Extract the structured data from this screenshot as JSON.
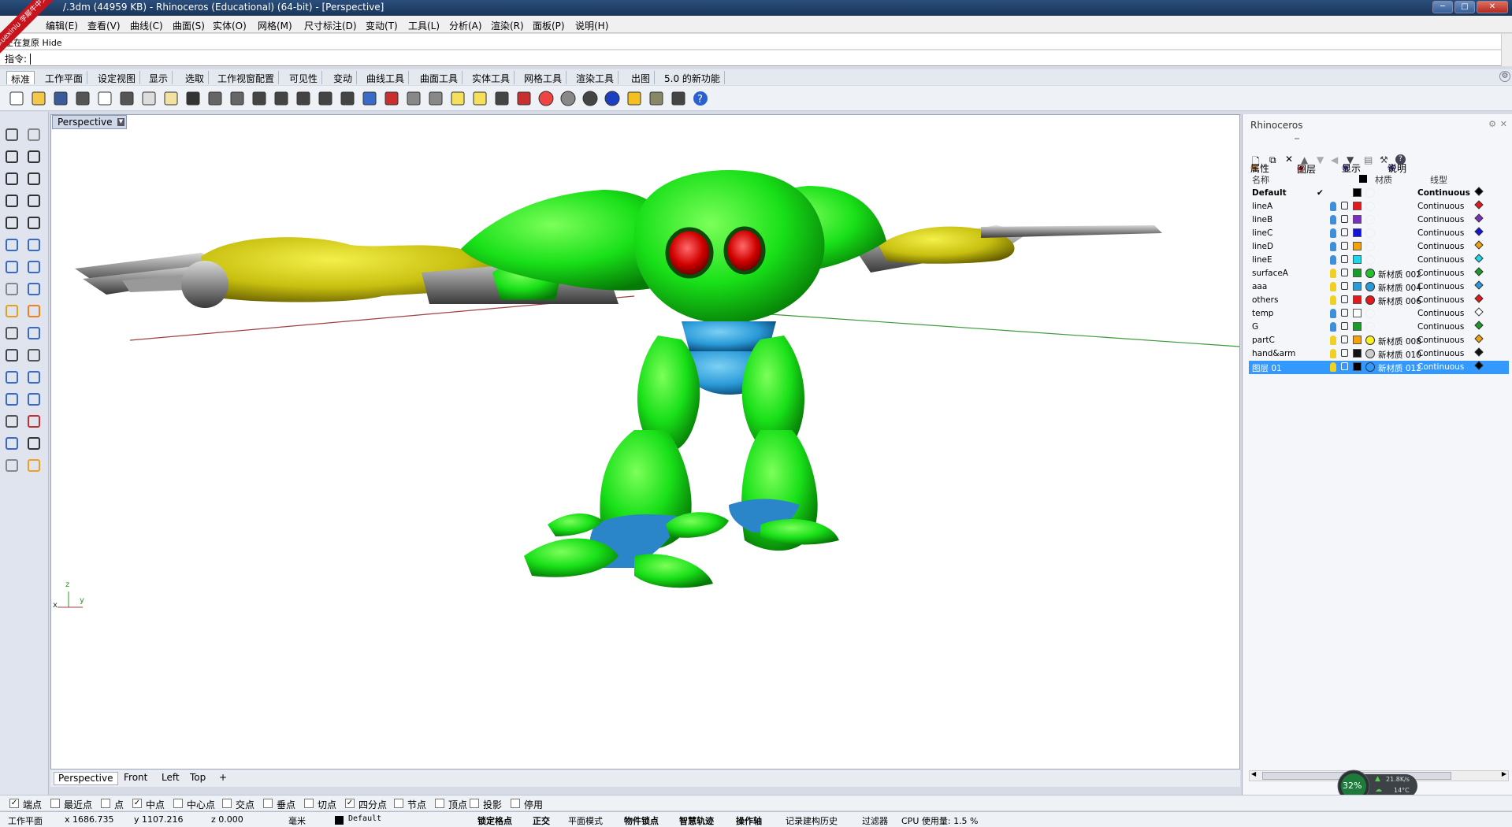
{
  "window": {
    "title": "/.3dm (44959 KB) - Rhinoceros (Educational) (64-bit) - [Perspective]",
    "watermark_line1": "xuexiniu",
    "watermark_line2": "学犀牛中文网"
  },
  "menu": [
    "编辑(E)",
    "查看(V)",
    "曲线(C)",
    "曲面(S)",
    "实体(O)",
    "网格(M)",
    "尺寸标注(D)",
    "变动(T)",
    "工具(L)",
    "分析(A)",
    "渲染(R)",
    "面板(P)",
    "说明(H)"
  ],
  "command": {
    "history": "正在复原 Hide",
    "prompt": "指令:",
    "value": ""
  },
  "toolbar_tabs": [
    "标准",
    "工作平面",
    "设定视图",
    "显示",
    "选取",
    "工作视窗配置",
    "可见性",
    "变动",
    "曲线工具",
    "曲面工具",
    "实体工具",
    "网格工具",
    "渲染工具",
    "出图",
    "5.0 的新功能"
  ],
  "toolbar_icons": [
    "new-icon",
    "open-icon",
    "save-icon",
    "print-icon",
    "import-icon",
    "cut-icon",
    "copy-icon",
    "paste-icon",
    "undo-icon",
    "pan-icon",
    "rotate-view-icon",
    "zoom-icon",
    "zoom-window-icon",
    "zoom-extents-icon",
    "zoom-selected-icon",
    "undo-view-icon",
    "four-viewports-icon",
    "car-icon",
    "wireframe-icon",
    "ghosted-icon",
    "light-icon",
    "bulb-icon",
    "lock-icon",
    "material-icon",
    "color-wheel-icon",
    "shaded-sphere-icon",
    "render-sphere-icon",
    "blue-sphere-icon",
    "select-icon",
    "options-icon",
    "cplane-icon",
    "help-icon"
  ],
  "viewport": {
    "active_label": "Perspective",
    "axis_x": "x",
    "axis_y": "y",
    "axis_z": "z",
    "tabs": [
      "Perspective",
      "Front",
      "Left",
      "Top"
    ],
    "add_tab": "+"
  },
  "panel": {
    "title": "Rhinoceros",
    "tabs": [
      "属性",
      "图层",
      "显示",
      "说明"
    ],
    "active_tab": "图层",
    "columns": {
      "name": "名称",
      "material": "材质",
      "linetype": "线型"
    },
    "layers": [
      {
        "name": "Default",
        "current": "✔",
        "color": "#000000",
        "material": "",
        "mat_color": "",
        "linetype": "Continuous",
        "print_color": "#000000",
        "bold": true,
        "bulb": ""
      },
      {
        "name": "lineA",
        "current": "",
        "color": "#e31a1c",
        "material": "",
        "mat_color": "",
        "linetype": "Continuous",
        "print_color": "#e31a1c",
        "bulb": "#3c8fd8"
      },
      {
        "name": "lineB",
        "current": "",
        "color": "#7b2fbf",
        "material": "",
        "mat_color": "",
        "linetype": "Continuous",
        "print_color": "#7b2fbf",
        "bulb": "#3c8fd8"
      },
      {
        "name": "lineC",
        "current": "",
        "color": "#1414d8",
        "material": "",
        "mat_color": "",
        "linetype": "Continuous",
        "print_color": "#1414d8",
        "bulb": "#3c8fd8"
      },
      {
        "name": "lineD",
        "current": "",
        "color": "#f2a20c",
        "material": "",
        "mat_color": "",
        "linetype": "Continuous",
        "print_color": "#f2a20c",
        "bulb": "#3c8fd8"
      },
      {
        "name": "lineE",
        "current": "",
        "color": "#19d8e8",
        "material": "",
        "mat_color": "",
        "linetype": "Continuous",
        "print_color": "#19d8e8",
        "bulb": "#3c8fd8"
      },
      {
        "name": "surfaceA",
        "current": "",
        "color": "#1a9a28",
        "material": "新材质 002",
        "mat_color": "#22c02e",
        "linetype": "Continuous",
        "print_color": "#1a9a28",
        "bulb": "#f0d020"
      },
      {
        "name": "aaa",
        "current": "",
        "color": "#2a9ad8",
        "material": "新材质 004",
        "mat_color": "#2a9ad8",
        "linetype": "Continuous",
        "print_color": "#2a9ad8",
        "bulb": "#f0d020"
      },
      {
        "name": "others",
        "current": "",
        "color": "#e31a1c",
        "material": "新材质 006",
        "mat_color": "#e31a1c",
        "linetype": "Continuous",
        "print_color": "#e31a1c",
        "bulb": "#f0d020"
      },
      {
        "name": "temp",
        "current": "",
        "color": "#ffffff",
        "material": "",
        "mat_color": "",
        "linetype": "Continuous",
        "print_color": "#ffffff",
        "bulb": "#3c8fd8"
      },
      {
        "name": "G",
        "current": "",
        "color": "#1a9a28",
        "material": "",
        "mat_color": "",
        "linetype": "Continuous",
        "print_color": "#1a9a28",
        "bulb": "#3c8fd8"
      },
      {
        "name": "partC",
        "current": "",
        "color": "#f2a20c",
        "material": "新材质 008",
        "mat_color": "#f8ee20",
        "linetype": "Continuous",
        "print_color": "#f2a20c",
        "bulb": "#f0d020"
      },
      {
        "name": "hand&arm",
        "current": "",
        "color": "#111111",
        "material": "新材质 010",
        "mat_color": "#cccccc",
        "linetype": "Continuous",
        "print_color": "#111111",
        "bulb": "#f0d020"
      },
      {
        "name": "图层 01",
        "current": "",
        "color": "#000000",
        "material": "新材质 012",
        "mat_color": "#3399ff",
        "linetype": "Continuous",
        "print_color": "#000000",
        "selected": true,
        "bulb": "#f0d020"
      }
    ]
  },
  "osnaps": [
    {
      "label": "端点",
      "checked": true
    },
    {
      "label": "最近点",
      "checked": false
    },
    {
      "label": "点",
      "checked": false
    },
    {
      "label": "中点",
      "checked": true
    },
    {
      "label": "中心点",
      "checked": false
    },
    {
      "label": "交点",
      "checked": false
    },
    {
      "label": "垂点",
      "checked": false
    },
    {
      "label": "切点",
      "checked": false
    },
    {
      "label": "四分点",
      "checked": true
    },
    {
      "label": "节点",
      "checked": false
    },
    {
      "label": "顶点",
      "checked": false
    },
    {
      "label": "投影",
      "checked": false
    },
    {
      "label": "停用",
      "checked": false
    }
  ],
  "status": {
    "cplane": "工作平面",
    "x": "x 1686.735",
    "y": "y 1107.216",
    "z": "z 0.000",
    "unit": "毫米",
    "layer": "Default",
    "items": [
      "锁定格点",
      "正交",
      "平面模式",
      "物件锁点",
      "智慧轨迹",
      "操作轴",
      "记录建构历史",
      "过滤器"
    ],
    "cpu": "CPU 使用量: 1.5 %"
  },
  "gauge": {
    "percent": "32%",
    "net": "21.8K/s",
    "temp": "14°C"
  }
}
